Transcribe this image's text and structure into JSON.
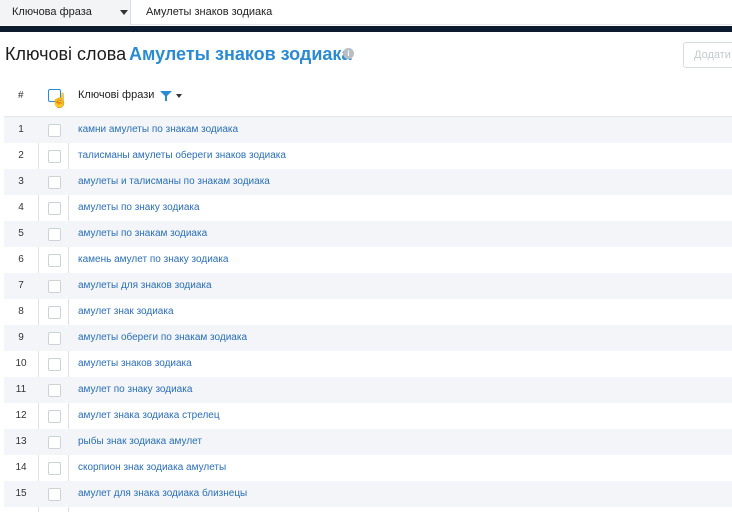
{
  "filter_bar": {
    "field_label": "Ключова фраза",
    "value": "Амулеты знаков зодиака"
  },
  "header": {
    "title_prefix": "Ключові слова",
    "title_phrase": "Амулеты знаков зодиака",
    "info_icon": "info-icon",
    "add_button": "Додати"
  },
  "table": {
    "columns": {
      "num": "#",
      "keyword": "Ключові фрази"
    },
    "rows": [
      {
        "num": "1",
        "keyword": "камни амулеты по знакам зодиака"
      },
      {
        "num": "2",
        "keyword": "талисманы амулеты обереги знаков зодиака"
      },
      {
        "num": "3",
        "keyword": "амулеты и талисманы по знакам зодиака"
      },
      {
        "num": "4",
        "keyword": "амулеты по знаку зодиака"
      },
      {
        "num": "5",
        "keyword": "амулеты по знакам зодиака"
      },
      {
        "num": "6",
        "keyword": "камень амулет по знаку зодиака"
      },
      {
        "num": "7",
        "keyword": "амулеты для знаков зодиака"
      },
      {
        "num": "8",
        "keyword": "амулет знак зодиака"
      },
      {
        "num": "9",
        "keyword": "амулеты обереги по знакам зодиака"
      },
      {
        "num": "10",
        "keyword": "амулеты знаков зодиака"
      },
      {
        "num": "11",
        "keyword": "амулет по знаку зодиака"
      },
      {
        "num": "12",
        "keyword": "амулет знака зодиака стрелец"
      },
      {
        "num": "13",
        "keyword": "рыбы знак зодиака амулет"
      },
      {
        "num": "14",
        "keyword": "скорпион знак зодиака амулеты"
      },
      {
        "num": "15",
        "keyword": "амулет для знака зодиака близнецы"
      }
    ]
  },
  "colors": {
    "accent": "#2a8bd3",
    "link": "#2a6fb8",
    "dark_bar": "#0d1b2f"
  }
}
